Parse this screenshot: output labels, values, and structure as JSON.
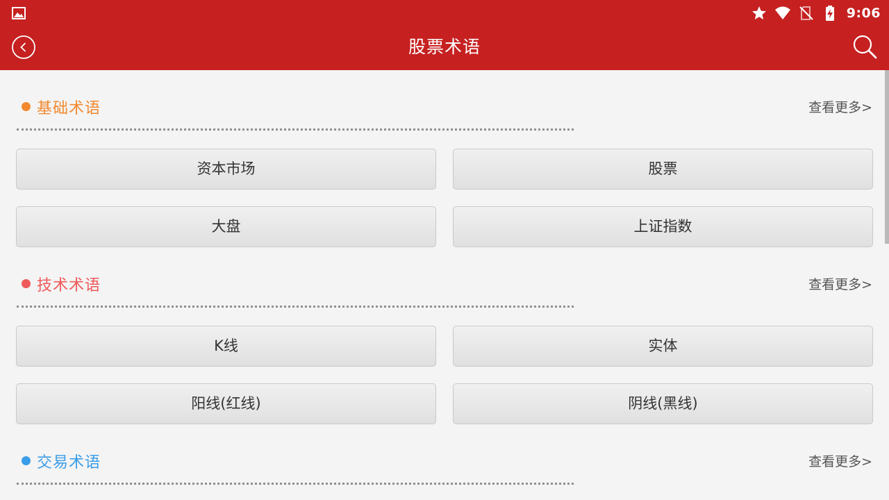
{
  "status_bar": {
    "time": "9:06",
    "icons": [
      "image-icon",
      "star-icon",
      "wifi-icon",
      "no-sim-icon",
      "battery-charging-icon"
    ]
  },
  "app_bar": {
    "title": "股票术语",
    "back_icon": "chevron-left-icon",
    "search_icon": "search-icon"
  },
  "colors": {
    "primary": "#c62020",
    "background": "#f4f4f4",
    "section_basic": "#f2892f",
    "section_technical": "#ef5a5a",
    "section_trading": "#3a9de8"
  },
  "sections": [
    {
      "title": "基础术语",
      "more": "查看更多>",
      "terms": [
        "资本市场",
        "股票",
        "大盘",
        "上证指数"
      ]
    },
    {
      "title": "技术术语",
      "more": "查看更多>",
      "terms": [
        "K线",
        "实体",
        "阳线(红线)",
        "阴线(黑线)"
      ]
    },
    {
      "title": "交易术语",
      "more": "查看更多>",
      "terms": []
    }
  ]
}
